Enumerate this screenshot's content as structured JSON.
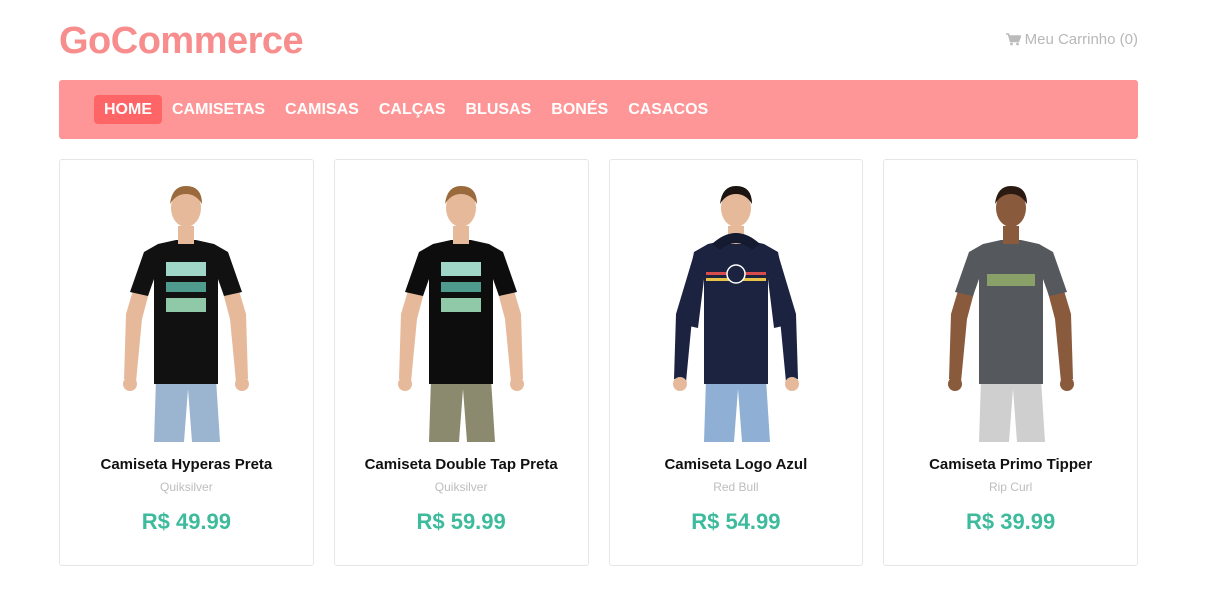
{
  "header": {
    "logo": "GoCommerce",
    "cart_label": "Meu Carrinho (0)"
  },
  "nav": {
    "items": [
      {
        "label": "HOME",
        "active": true
      },
      {
        "label": "CAMISETAS",
        "active": false
      },
      {
        "label": "CAMISAS",
        "active": false
      },
      {
        "label": "CALÇAS",
        "active": false
      },
      {
        "label": "BLUSAS",
        "active": false
      },
      {
        "label": "BONÉS",
        "active": false
      },
      {
        "label": "CASACOS",
        "active": false
      }
    ]
  },
  "products": [
    {
      "name": "Camiseta Hyperas Preta",
      "brand": "Quiksilver",
      "price": "R$ 49.99",
      "image": "man-black-tshirt",
      "shirt_color": "#111111",
      "print_text": "SILV",
      "pants_color": "#9bb5d0"
    },
    {
      "name": "Camiseta Double Tap Preta",
      "brand": "Quiksilver",
      "price": "R$ 59.99",
      "image": "man-black-tshirt",
      "shirt_color": "#0d0d0d",
      "print_text": "QUIK SILVER",
      "pants_color": "#8c8a6e"
    },
    {
      "name": "Camiseta Logo Azul",
      "brand": "Red Bull",
      "price": "R$ 54.99",
      "image": "man-navy-hoodie",
      "shirt_color": "#1b2340",
      "print_text": "",
      "pants_color": "#8fb0d4"
    },
    {
      "name": "Camiseta Primo Tipper",
      "brand": "Rip Curl",
      "price": "R$ 39.99",
      "image": "man-grey-tshirt",
      "shirt_color": "#55585c",
      "print_text": "RIPCURL",
      "pants_color": "#cfcfcf"
    }
  ],
  "colors": {
    "brand": "#f78d8d",
    "navbar": "#fe9697",
    "nav_active": "#fd6566",
    "price": "#3dbb9c"
  }
}
